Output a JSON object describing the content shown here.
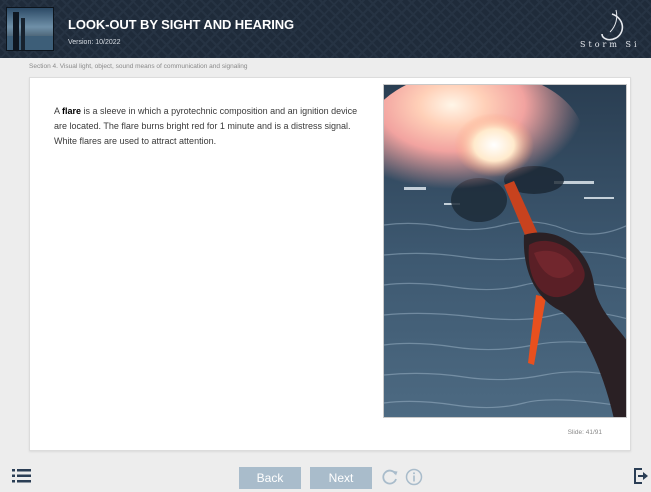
{
  "header": {
    "title": "LOOK-OUT BY SIGHT AND HEARING",
    "version": "Version: 10/2022",
    "logo_text": "Storm Si"
  },
  "breadcrumb": "Section 4. Visual light, object, sound means of communication and signaling",
  "content": {
    "term": "flare",
    "intro": "A ",
    "body": " is a sleeve in which a pyrotechnic composition and an ignition device are located. The flare burns bright red for 1 minute and is a distress signal. White flares are used to attract attention."
  },
  "slide_counter": "Slide: 41/91",
  "nav": {
    "back_label": "Back",
    "next_label": "Next"
  },
  "icons": {
    "menu": "list-menu-icon",
    "reload": "reload-icon",
    "info": "info-icon",
    "exit": "exit-icon"
  },
  "colors": {
    "header_bg": "#1f2b3a",
    "nav_button": "#a9bccb",
    "icon": "#2b3e55"
  }
}
